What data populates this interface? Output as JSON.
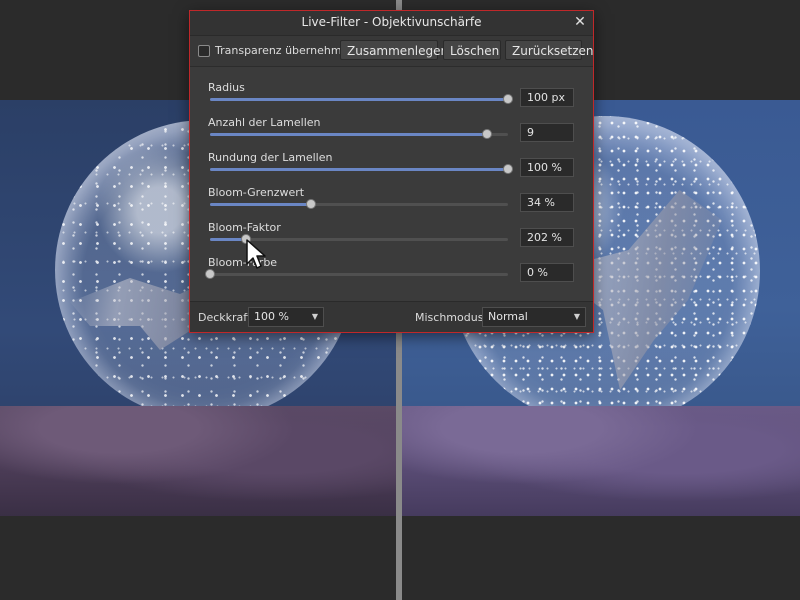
{
  "dialog": {
    "title": "Live-Filter - Objektivunschärfe",
    "close_icon": "close-icon",
    "toolbar": {
      "transparency_label": "Transparenz übernehmen",
      "transparency_checked": false,
      "merge_label": "Zusammenlegen",
      "delete_label": "Löschen",
      "reset_label": "Zurücksetzen"
    },
    "params": [
      {
        "label": "Radius",
        "value": "100 px",
        "level": 1.0
      },
      {
        "label": "Anzahl der Lamellen",
        "value": "9",
        "level": 0.93
      },
      {
        "label": "Rundung der Lamellen",
        "value": "100 %",
        "level": 1.0
      },
      {
        "label": "Bloom-Grenzwert",
        "value": "34 %",
        "level": 0.34
      },
      {
        "label": "Bloom-Faktor",
        "value": "202 %",
        "level": 0.12
      },
      {
        "label": "Bloom-Farbe",
        "value": "0 %",
        "level": 0.0
      }
    ],
    "footer": {
      "opacity_label": "Deckkraft:",
      "opacity_value": "100 %",
      "blend_label": "Mischmodus:",
      "blend_value": "Normal"
    }
  },
  "colors": {
    "accent": "#6a86c4",
    "dialog_border": "#c0282a"
  }
}
